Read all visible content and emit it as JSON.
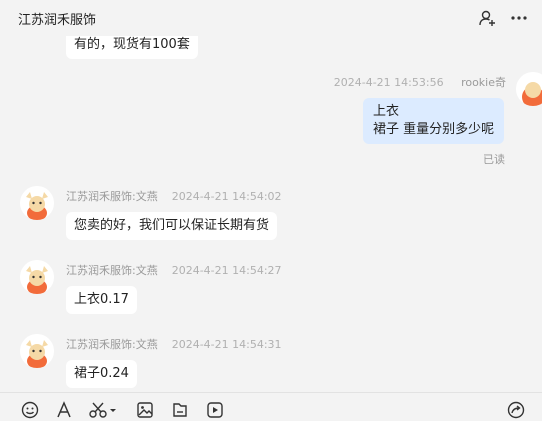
{
  "header": {
    "title": "江苏润禾服饰"
  },
  "messages": [
    {
      "sender": "",
      "time": "",
      "lines": [
        "有的，现货有100套"
      ]
    },
    {
      "sender": "rookie奇",
      "time": "2024-4-21 14:53:56",
      "lines": [
        "上衣",
        "裙子 重量分别多少呢"
      ],
      "status": "已读"
    },
    {
      "sender": "江苏润禾服饰:文燕",
      "time": "2024-4-21 14:54:02",
      "lines": [
        "您卖的好，我们可以保证长期有货"
      ]
    },
    {
      "sender": "江苏润禾服饰:文燕",
      "time": "2024-4-21 14:54:27",
      "lines": [
        "上衣0.17"
      ]
    },
    {
      "sender": "江苏润禾服饰:文燕",
      "time": "2024-4-21 14:54:31",
      "lines": [
        "裙子0.24"
      ]
    }
  ],
  "icons": {
    "add_user": "add-user-icon",
    "more": "more-icon",
    "emoji": "emoji-icon",
    "font": "font-icon",
    "screenshot": "scissors-icon",
    "image": "image-icon",
    "file": "file-icon",
    "video": "video-icon",
    "send": "send-icon"
  },
  "colors": {
    "background": "#f3f3f3",
    "bubble_other": "#ffffff",
    "bubble_mine": "#dcebff",
    "avatar_accent": "#f26b3a"
  }
}
